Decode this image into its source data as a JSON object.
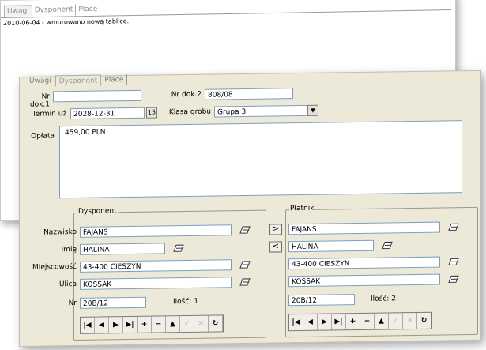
{
  "back_window": {
    "tabs": [
      "Uwagi",
      "Dysponent",
      "Place"
    ],
    "note": "2010-06-04 - wmurowano nową tablicę."
  },
  "front_window": {
    "tabs": [
      "Uwagi",
      "Dysponent",
      "Place"
    ],
    "nr_dok1": {
      "label": "Nr dok.1",
      "value": ""
    },
    "nr_dok2": {
      "label": "Nr dok.2",
      "value": "808/08"
    },
    "termin": {
      "label": "Termin uż.",
      "value": "2028-12-31"
    },
    "klasa": {
      "label": "Klasa grobu",
      "value": "Grupa 3"
    },
    "oplata": {
      "label": "Opłata",
      "value": "459,00 PLN"
    },
    "dysponent": {
      "title": "Dysponent",
      "labels": {
        "nazwisko": "Nazwisko",
        "imie": "Imię",
        "miejscowosc": "Miejscowość",
        "ulica": "Ulica",
        "nr": "Nr"
      },
      "nazwisko": "FAJANS",
      "imie": "HALINA",
      "miejscowosc": "43-400 CIESZYN",
      "ulica": "KOSSAK",
      "nr": "20B/12",
      "ilosc": "Ilość:  1"
    },
    "platnik": {
      "title": "Płatnik",
      "nazwisko": "FAJANS",
      "imie": "HALINA",
      "miejscowosc": "43-400 CIESZYN",
      "ulica": "KOSSAK",
      "nr": "20B/12",
      "ilosc": "Ilość:  2"
    },
    "transfer": {
      "right": ">",
      "left": "<"
    },
    "nav": [
      "|◀",
      "◀",
      "▶",
      "▶|",
      "+",
      "−",
      "▲",
      "✓",
      "✕",
      "↻"
    ]
  }
}
